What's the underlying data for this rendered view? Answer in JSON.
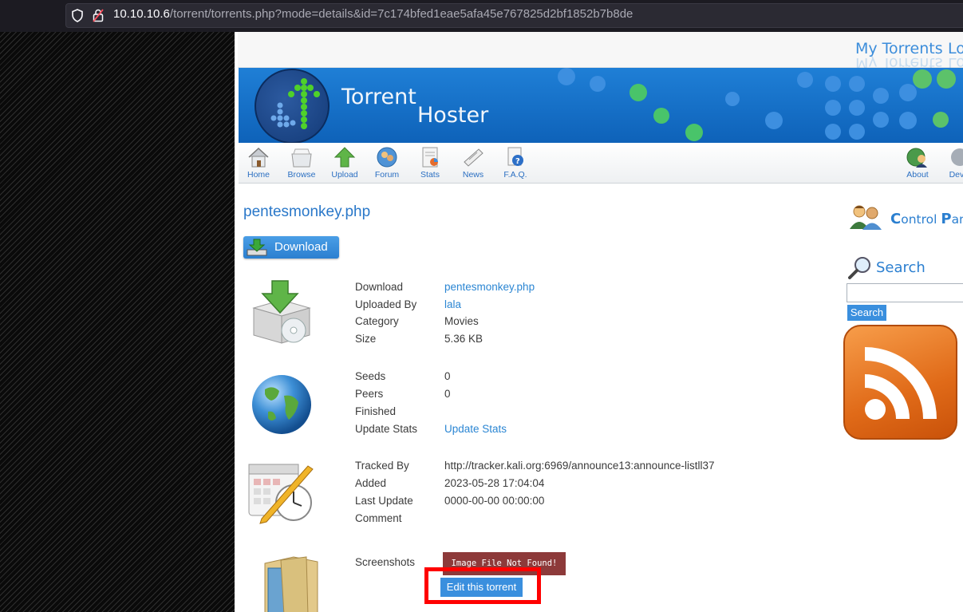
{
  "browser": {
    "url_host": "10.10.10.6",
    "url_path": "/torrent/torrents.php?mode=details&id=7c174bfed1eae5afa45e767825d2bf1852b7b8de"
  },
  "header": {
    "links": [
      "My Torrents",
      "Log"
    ],
    "brand_line1": "Torrent",
    "brand_line2": "Hoster"
  },
  "nav": {
    "items": [
      "Home",
      "Browse",
      "Upload",
      "Forum",
      "Stats",
      "News",
      "F.A.Q."
    ],
    "right_items": [
      "About",
      "Devel"
    ]
  },
  "torrent": {
    "title": "pentesmonkey.php",
    "download_button": "Download",
    "sections": [
      {
        "icon": "package-cd-icon",
        "rows": [
          {
            "label": "Download",
            "value": "pentesmonkey.php",
            "link": true
          },
          {
            "label": "Uploaded By",
            "value": "lala",
            "link": true
          },
          {
            "label": "Category",
            "value": "Movies",
            "link": false
          },
          {
            "label": "Size",
            "value": "5.36 KB",
            "link": false
          }
        ]
      },
      {
        "icon": "globe-icon",
        "rows": [
          {
            "label": "Seeds",
            "value": "0",
            "link": false
          },
          {
            "label": "Peers",
            "value": "0",
            "link": false
          },
          {
            "label": "Finished",
            "value": "",
            "link": false
          },
          {
            "label": "Update Stats",
            "value": "Update Stats",
            "link": true
          }
        ]
      },
      {
        "icon": "calendar-clock-icon",
        "rows": [
          {
            "label": "Tracked By",
            "value": "http://tracker.kali.org:6969/announce13:announce-listll37",
            "link": false
          },
          {
            "label": "Added",
            "value": "2023-05-28 17:04:04",
            "link": false
          },
          {
            "label": "Last Update",
            "value": "0000-00-00 00:00:00",
            "link": false
          },
          {
            "label": "Comment",
            "value": "",
            "link": false
          }
        ]
      }
    ],
    "screenshots_label": "Screenshots",
    "image_not_found": "Image File Not Found!",
    "edit_button": "Edit this torrent"
  },
  "sidebar": {
    "control_panel_first": "C",
    "control_panel_rest1": "ontrol ",
    "control_panel_second": "P",
    "control_panel_rest2": "anel",
    "search_label": "Search",
    "search_button": "Search",
    "search_value": ""
  },
  "colors": {
    "link": "#2b86d3",
    "highlight": "#ff0000",
    "banner": "#1f7fd6",
    "rss": "#e06a18"
  }
}
